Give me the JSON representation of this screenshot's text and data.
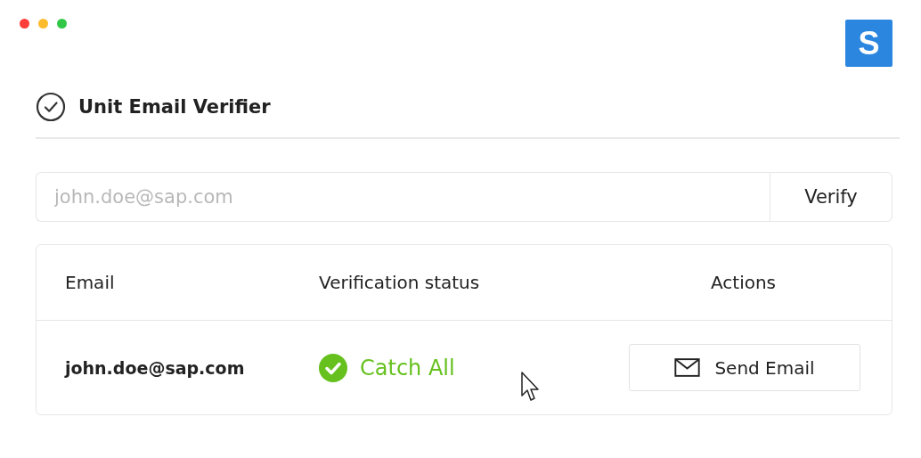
{
  "logo": "S",
  "title": "Unit Email Verifier",
  "email_field": {
    "placeholder": "john.doe@sap.com"
  },
  "verify_button": "Verify",
  "table": {
    "columns": [
      "Email",
      "Verification status",
      "Actions"
    ],
    "rows": [
      {
        "email": "john.doe@sap.com",
        "status": {
          "label": "Catch All",
          "kind": "success"
        },
        "action": "Send Email"
      }
    ]
  }
}
